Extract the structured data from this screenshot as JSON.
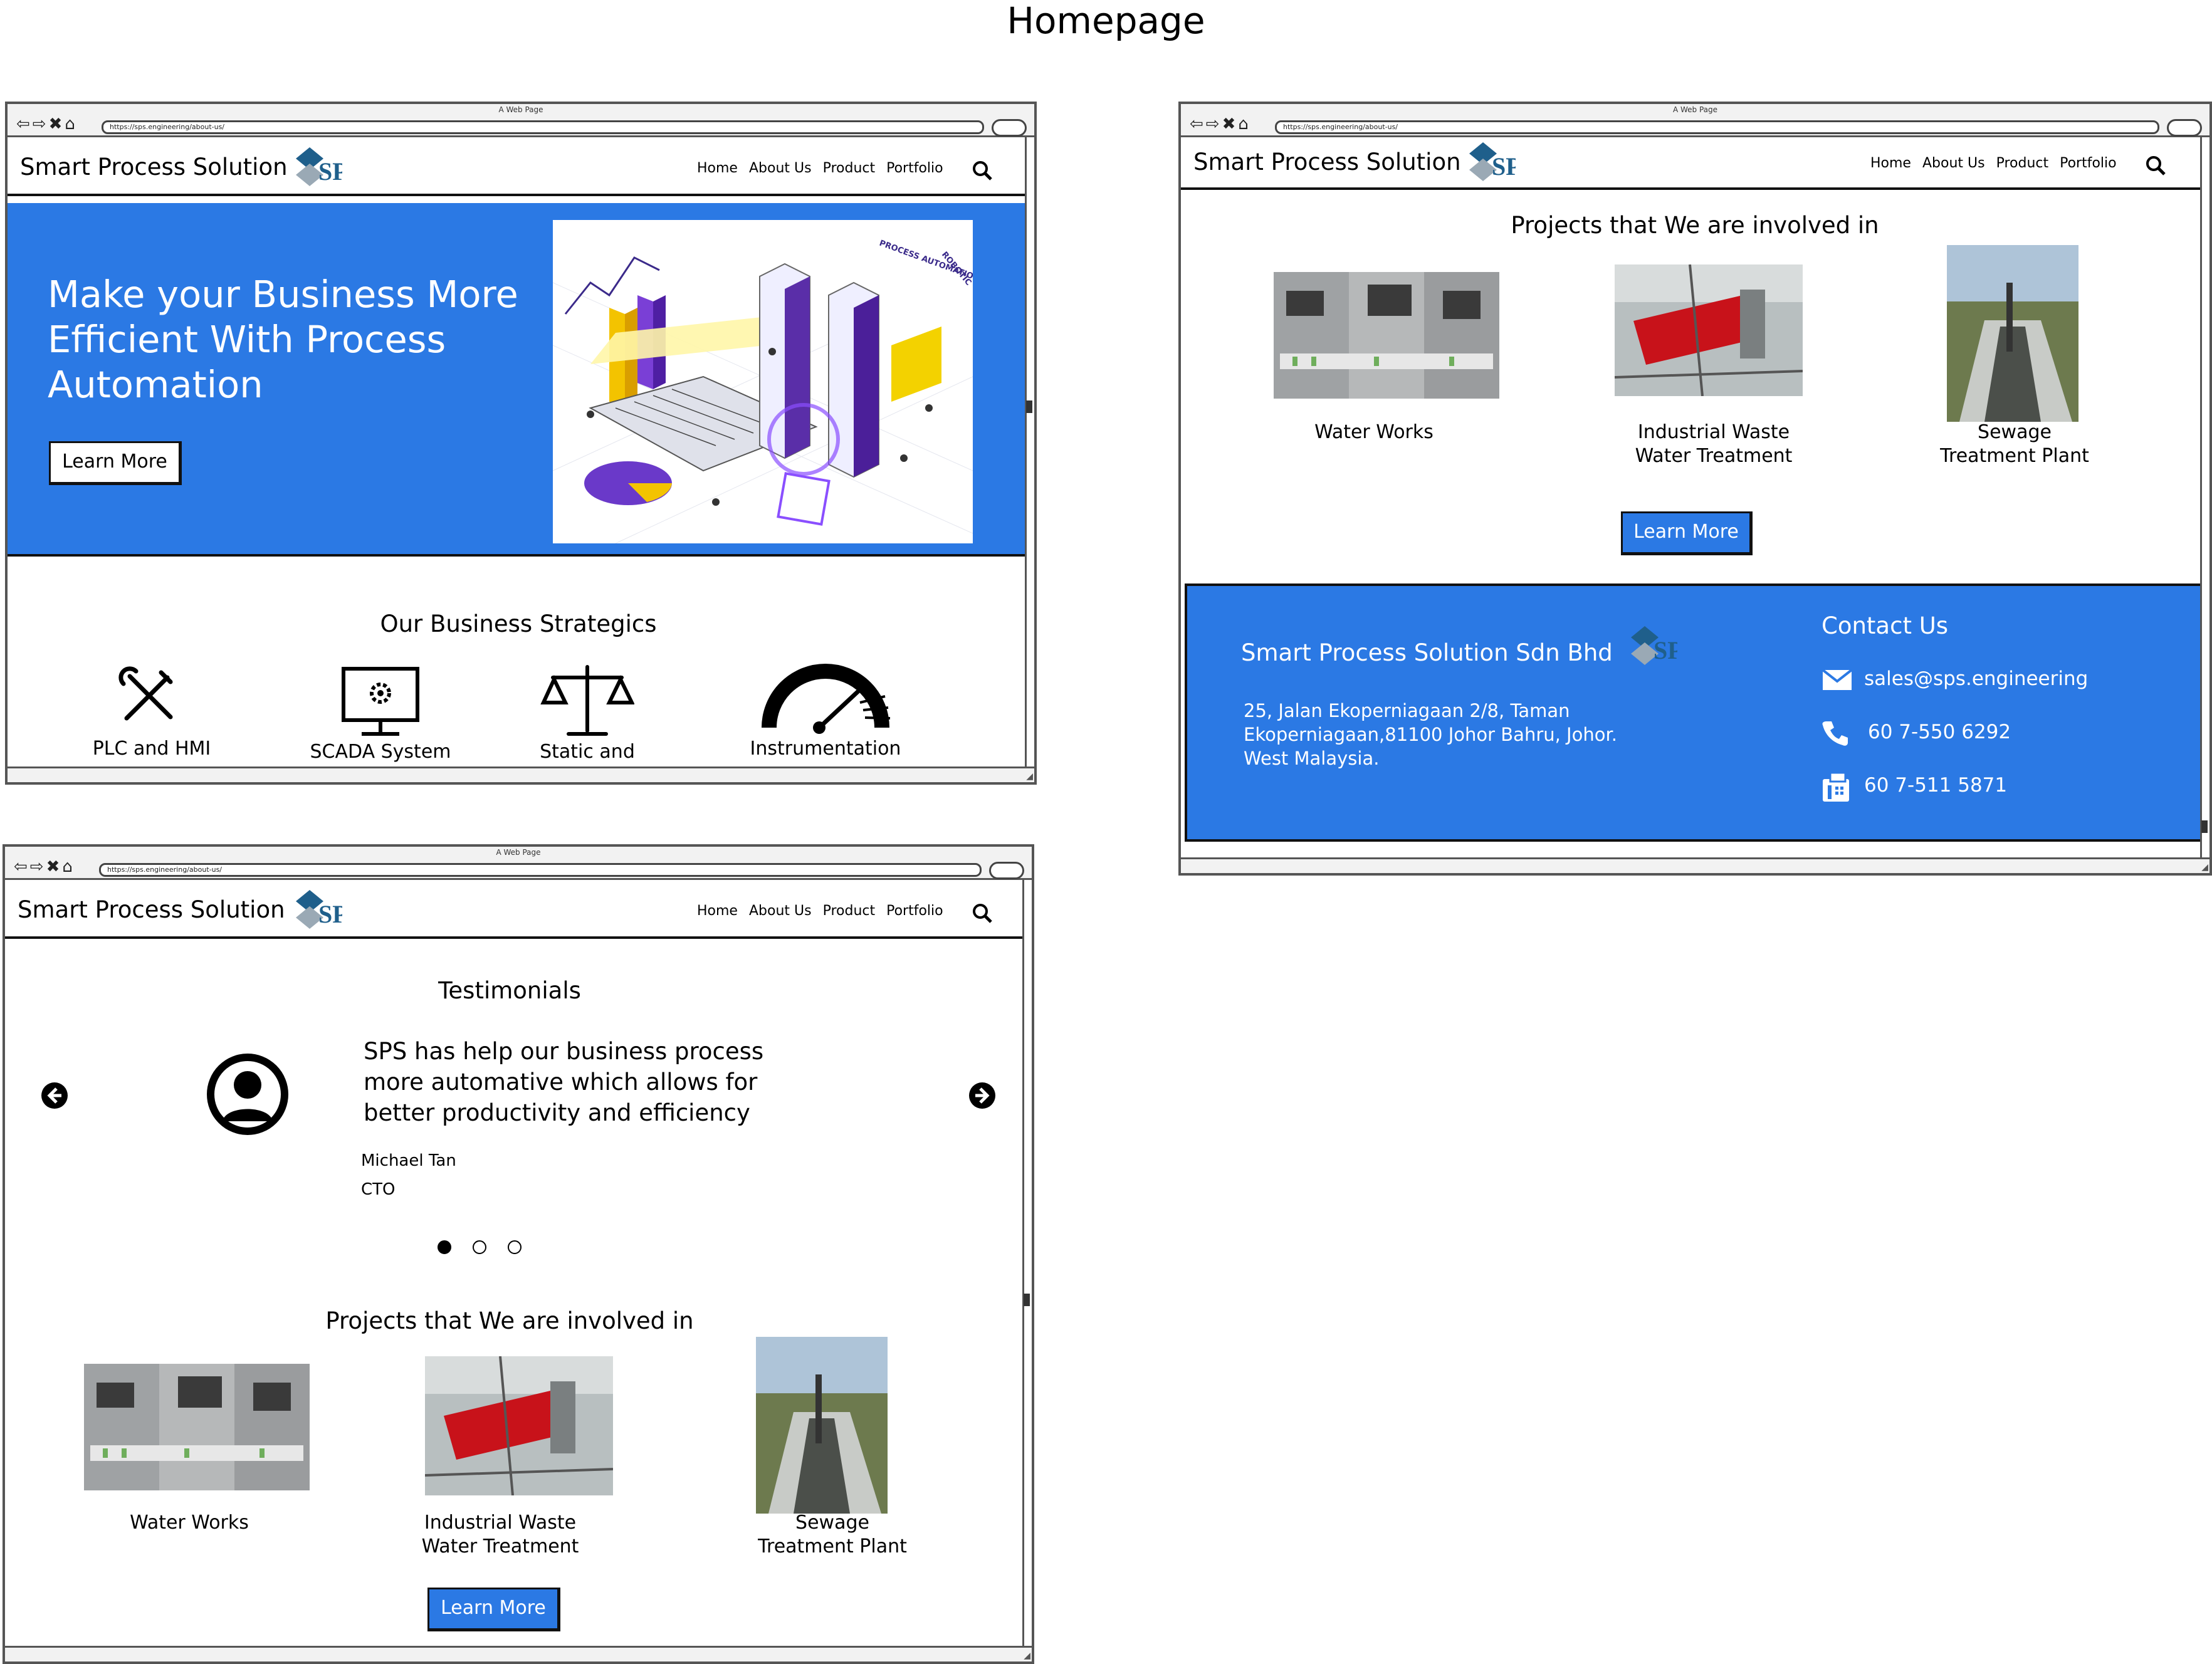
{
  "page_title": "Homepage",
  "window_title": "A Web Page",
  "url": "https://sps.engineering/about-us/",
  "brand": "Smart Process Solution",
  "logo_text": "SPS",
  "nav": [
    "Home",
    "About Us",
    "Product",
    "Portfolio"
  ],
  "hero": {
    "heading_lines": [
      "Make your Business More",
      "Efficient With Process",
      "Automation"
    ],
    "button": "Learn More",
    "illustration_labels": [
      "PROCESS AUTOMATION",
      "ROBOTIC"
    ]
  },
  "strategies": {
    "title": "Our Business Strategics",
    "items": [
      {
        "label": "PLC and HMI",
        "icon": "tools-icon"
      },
      {
        "label": "SCADA System",
        "icon": "monitor-gear-icon"
      },
      {
        "label": "Static and",
        "icon": "scale-icon"
      },
      {
        "label": "Instrumentation",
        "icon": "gauge-icon"
      }
    ]
  },
  "projects": {
    "title": "Projects that We are involved in",
    "items": [
      {
        "line1": "Water Works",
        "line2": ""
      },
      {
        "line1": "Industrial Waste",
        "line2": "Water Treatment"
      },
      {
        "line1": "Sewage",
        "line2": "Treatment Plant"
      }
    ],
    "button": "Learn More"
  },
  "footer": {
    "company": "Smart Process Solution Sdn Bhd",
    "address_lines": [
      "25, Jalan Ekoperniagaan 2/8, Taman",
      "Ekoperniagaan,81100 Johor Bahru, Johor.",
      "West Malaysia."
    ],
    "contact_title": "Contact Us",
    "email": "sales@sps.engineering",
    "phone": "60 7-550 6292",
    "fax": "60 7-511 5871"
  },
  "testimonials": {
    "title": "Testimonials",
    "quote_lines": [
      "SPS has help our business process",
      "more automative which allows for",
      "better productivity and efficiency"
    ],
    "name": "Michael Tan",
    "role": "CTO",
    "dots": 3,
    "active_dot": 0
  },
  "colors": {
    "accent": "#2b79e4",
    "frame": "#555555",
    "text": "#000000"
  }
}
